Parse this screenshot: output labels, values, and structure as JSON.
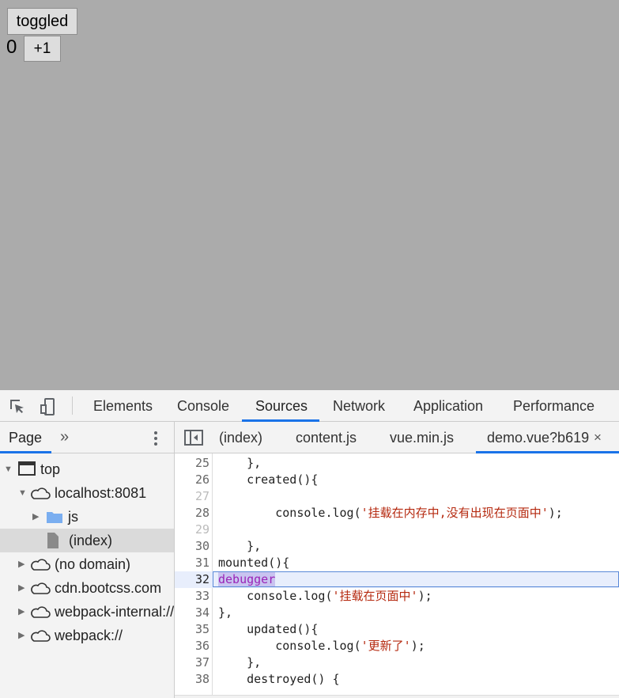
{
  "page": {
    "toggle_button": "toggled",
    "count": "0",
    "plus_button": "+1"
  },
  "devtools": {
    "tabs": [
      "Elements",
      "Console",
      "Sources",
      "Network",
      "Application",
      "Performance"
    ],
    "active_tab": "Sources",
    "navigator": {
      "tab_label": "Page",
      "more_symbol": "»",
      "tree": [
        {
          "label": "top"
        },
        {
          "label": "localhost:8081"
        },
        {
          "label": "js"
        },
        {
          "label": "(index)"
        },
        {
          "label": "(no domain)"
        },
        {
          "label": "cdn.bootcss.com"
        },
        {
          "label": "webpack-internal://"
        },
        {
          "label": "webpack://"
        }
      ]
    },
    "editor": {
      "tabs": [
        "(index)",
        "content.js",
        "vue.min.js",
        "demo.vue?b619"
      ],
      "close_symbol": "×",
      "lines": [
        {
          "num": "25",
          "parts": [
            {
              "t": "    },"
            }
          ]
        },
        {
          "num": "26",
          "parts": [
            {
              "t": "    created(){"
            }
          ]
        },
        {
          "num": "27",
          "parts": [
            {
              "t": ""
            }
          ]
        },
        {
          "num": "28",
          "parts": [
            {
              "t": "        console.log("
            },
            {
              "t": "'挂载在内存中,没有出现在页面中'",
              "c": "str"
            },
            {
              "t": ");"
            }
          ]
        },
        {
          "num": "29",
          "parts": [
            {
              "t": ""
            }
          ]
        },
        {
          "num": "30",
          "parts": [
            {
              "t": "    },"
            }
          ]
        },
        {
          "num": "31",
          "parts": [
            {
              "t": "mounted(){"
            }
          ]
        },
        {
          "num": "32",
          "parts": [
            {
              "t": "debugger",
              "c": "hl-word"
            }
          ]
        },
        {
          "num": "33",
          "parts": [
            {
              "t": "    console.log("
            },
            {
              "t": "'挂载在页面中'",
              "c": "str"
            },
            {
              "t": ");"
            }
          ]
        },
        {
          "num": "34",
          "parts": [
            {
              "t": "},"
            }
          ]
        },
        {
          "num": "35",
          "parts": [
            {
              "t": "    updated(){"
            }
          ]
        },
        {
          "num": "36",
          "parts": [
            {
              "t": "        console.log("
            },
            {
              "t": "'更新了'",
              "c": "str"
            },
            {
              "t": ");"
            }
          ]
        },
        {
          "num": "37",
          "parts": [
            {
              "t": "    },"
            }
          ]
        },
        {
          "num": "38",
          "parts": [
            {
              "t": "    destroyed() {"
            }
          ]
        }
      ]
    }
  }
}
